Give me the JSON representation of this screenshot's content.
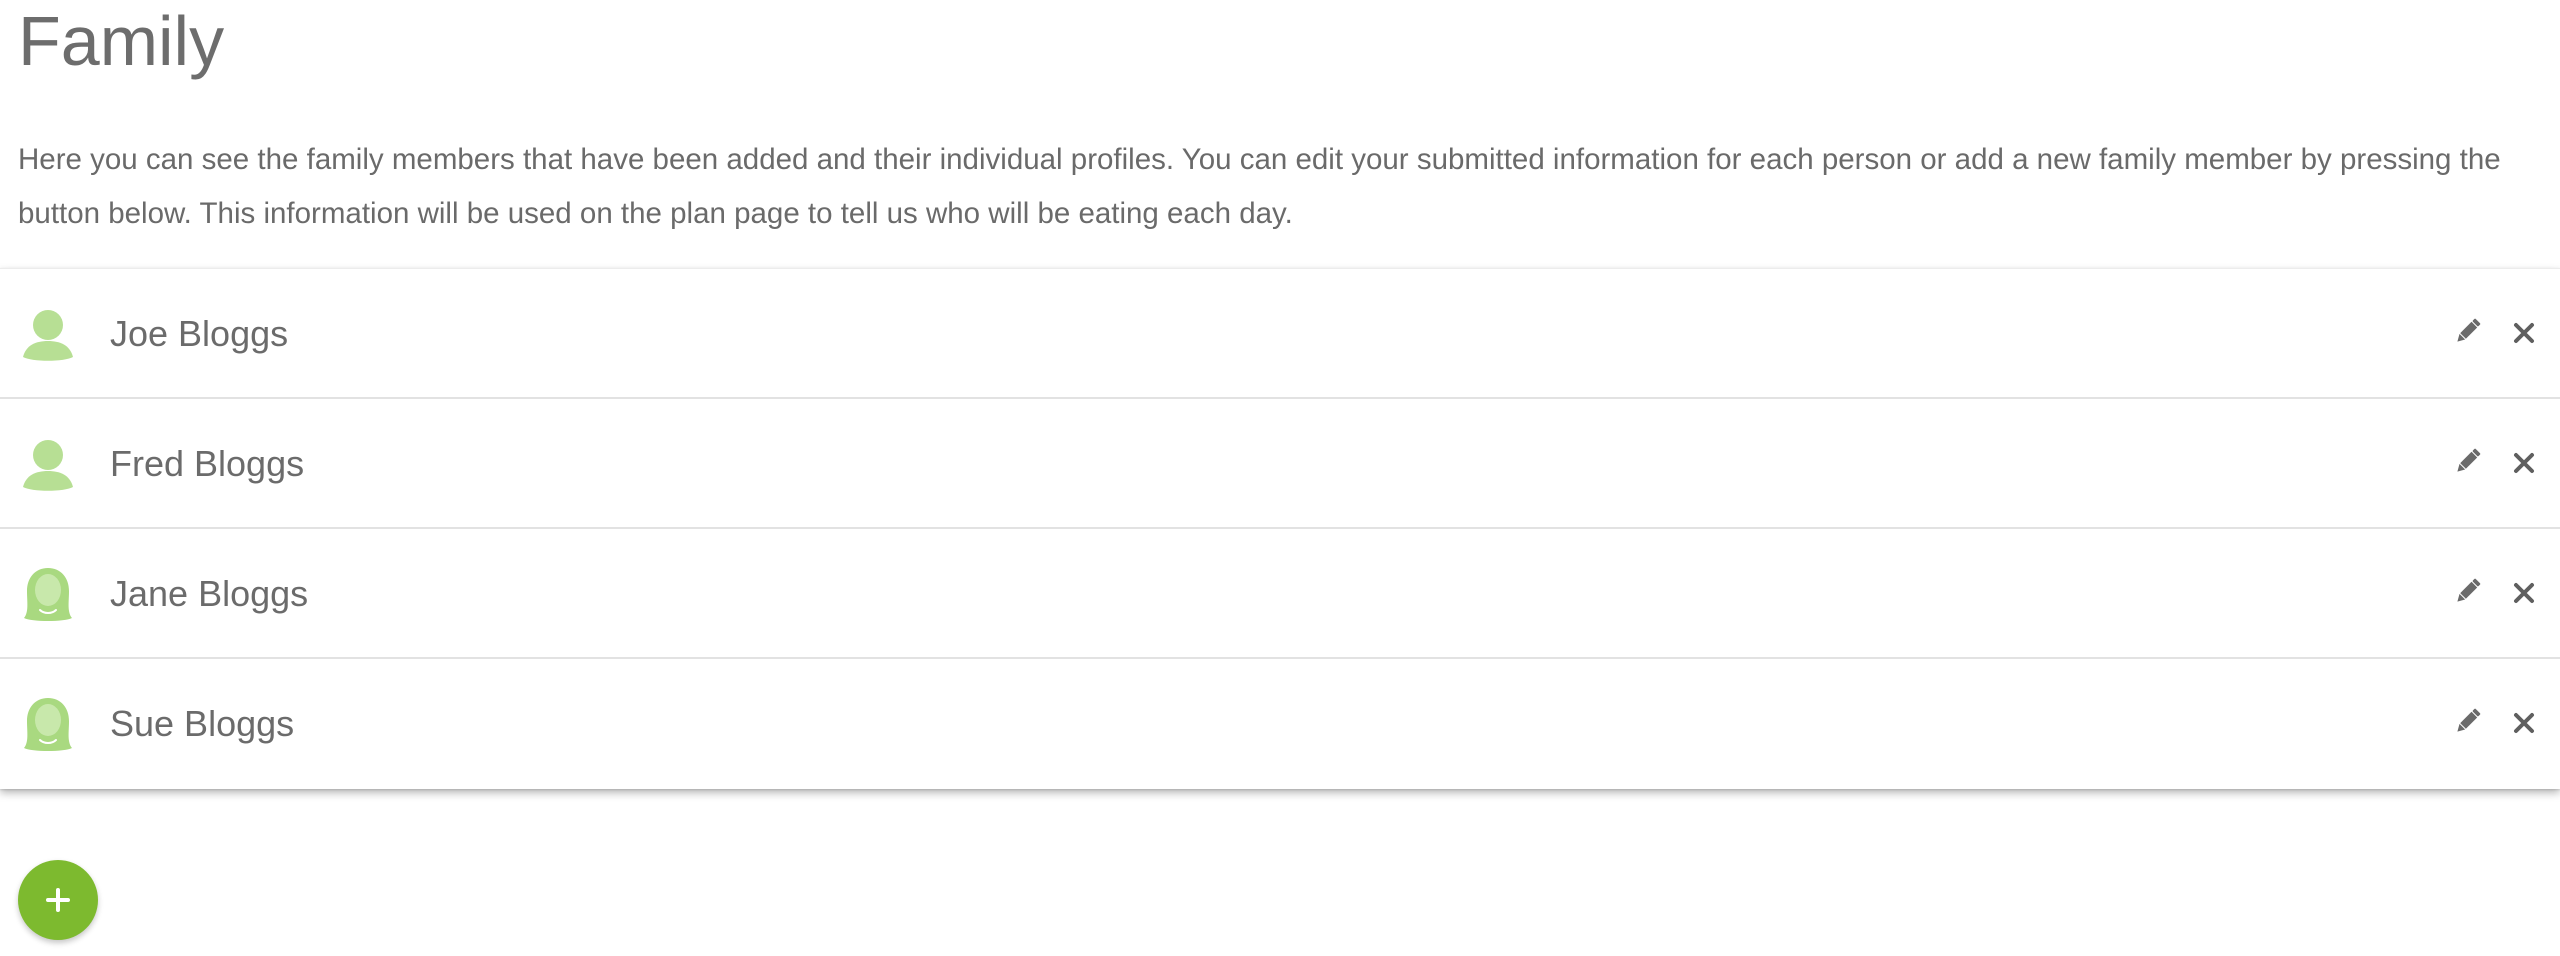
{
  "page": {
    "title": "Family",
    "intro": "Here you can see the family members that have been added and their individual profiles. You can edit your submitted information for each person or add a new family member by pressing the button below. This information will be used on the plan page to tell us who will be eating each day."
  },
  "members": [
    {
      "name": "Joe Bloggs",
      "avatar": "male-avatar-icon"
    },
    {
      "name": "Fred Bloggs",
      "avatar": "male-avatar-icon"
    },
    {
      "name": "Jane Bloggs",
      "avatar": "female-avatar-icon"
    },
    {
      "name": "Sue Bloggs",
      "avatar": "female-avatar-icon"
    }
  ],
  "actions": {
    "edit_icon": "pencil-icon",
    "delete_icon": "close-icon",
    "add_icon": "plus-icon"
  },
  "colors": {
    "accent": "#7dba2f",
    "avatar": "#b7df94",
    "text": "#6b6b6b"
  }
}
